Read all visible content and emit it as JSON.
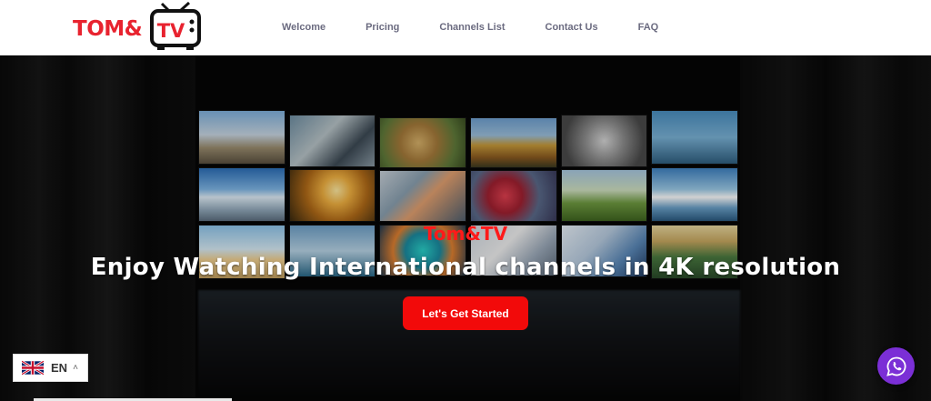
{
  "logo": {
    "text": "TOM&",
    "tv_text": "TV"
  },
  "nav": {
    "items": [
      {
        "label": "Welcome"
      },
      {
        "label": "Pricing"
      },
      {
        "label": "Channels List"
      },
      {
        "label": "Contact Us"
      },
      {
        "label": "FAQ"
      }
    ]
  },
  "hero": {
    "brand": "Tom&TV",
    "headline": "Enjoy Watching International channels in 4K resolution",
    "cta_label": "Let's Get Started"
  },
  "language": {
    "code": "EN"
  },
  "icons": {
    "flag": "uk-flag-icon",
    "caret": "chevron-up-icon",
    "chat": "whatsapp-icon"
  },
  "colors": {
    "brand_red": "#e8232f",
    "cta_red": "#f20a0a",
    "nav_gray": "#6b6b80",
    "chat_purple": "#7b2fd6"
  }
}
